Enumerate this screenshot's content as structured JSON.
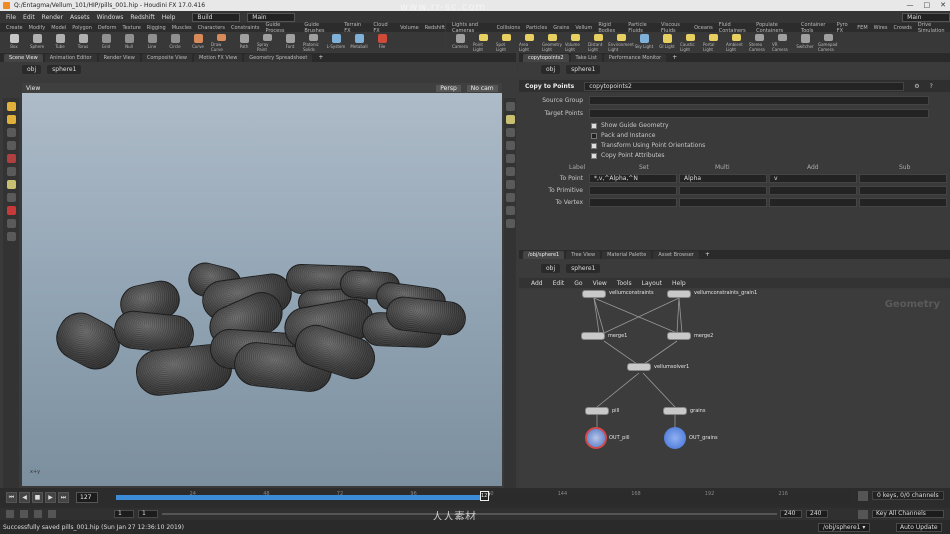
{
  "window": {
    "title": "Q:/Entagma/Vellum_101/HIP/pills_001.hip - Houdini FX 17.0.416",
    "controls": [
      "—",
      "□",
      "✕"
    ]
  },
  "watermark": {
    "top": "www.rr-sc.com",
    "bottom": "人人素材"
  },
  "menubar": {
    "items": [
      "File",
      "Edit",
      "Render",
      "Assets",
      "Windows",
      "Redshift",
      "Help"
    ],
    "desktop": "Build",
    "context": "Main"
  },
  "shelf_tabs_left": [
    "Create",
    "Modify",
    "Model",
    "Polygon",
    "Deform",
    "Texture",
    "Rigging",
    "Muscles",
    "Characters",
    "Constraints",
    "Guide Process",
    "Guide Brushes",
    "Terrain FX",
    "Cloud FX",
    "Volume",
    "Redshift"
  ],
  "shelf_tabs_right": [
    "Lights and Cameras",
    "Collisions",
    "Particles",
    "Grains",
    "Vellum",
    "Rigid Bodies",
    "Particle Fluids",
    "Viscous Fluids",
    "Oceans",
    "Fluid Containers",
    "Populate Containers",
    "Container Tools",
    "Pyro FX",
    "FEM",
    "Wires",
    "Crowds",
    "Drive Simulation"
  ],
  "shelf_tools_left": [
    {
      "label": "Box",
      "color": "#c7c7c7"
    },
    {
      "label": "Sphere",
      "color": "#b0b0b0"
    },
    {
      "label": "Tube",
      "color": "#b0b0b0"
    },
    {
      "label": "Torus",
      "color": "#b0b0b0"
    },
    {
      "label": "Grid",
      "color": "#909090"
    },
    {
      "label": "Null",
      "color": "#909090"
    },
    {
      "label": "Line",
      "color": "#909090"
    },
    {
      "label": "Circle",
      "color": "#909090"
    },
    {
      "label": "Curve",
      "color": "#d88a5a"
    },
    {
      "label": "Draw Curve",
      "color": "#d88a5a"
    },
    {
      "label": "Path",
      "color": "#a0a0a0"
    },
    {
      "label": "Spray Paint",
      "color": "#a0a0a0"
    },
    {
      "label": "Font",
      "color": "#a0a0a0"
    },
    {
      "label": "Platonic Solids",
      "color": "#a0a0a0"
    },
    {
      "label": "L-System",
      "color": "#7fb0d8"
    },
    {
      "label": "Metaball",
      "color": "#7fb0d8"
    },
    {
      "label": "File",
      "color": "#d04a3a"
    }
  ],
  "shelf_tools_right": [
    {
      "label": "Camera",
      "color": "#a0a0a0"
    },
    {
      "label": "Point Light",
      "color": "#e8d060"
    },
    {
      "label": "Spot Light",
      "color": "#e8d060"
    },
    {
      "label": "Area Light",
      "color": "#e8d060"
    },
    {
      "label": "Geometry Light",
      "color": "#e8d060"
    },
    {
      "label": "Volume Light",
      "color": "#e8d060"
    },
    {
      "label": "Distant Light",
      "color": "#e8d060"
    },
    {
      "label": "Environment Light",
      "color": "#e8d060"
    },
    {
      "label": "Sky Light",
      "color": "#7fb0d8"
    },
    {
      "label": "GI Light",
      "color": "#e8d060"
    },
    {
      "label": "Caustic Light",
      "color": "#e8d060"
    },
    {
      "label": "Portal Light",
      "color": "#e8d060"
    },
    {
      "label": "Ambient Light",
      "color": "#e8d060"
    },
    {
      "label": "Stereo Camera",
      "color": "#a0a0a0"
    },
    {
      "label": "VR Camera",
      "color": "#a0a0a0"
    },
    {
      "label": "Switcher",
      "color": "#a0a0a0"
    },
    {
      "label": "Gamepad Camera",
      "color": "#a0a0a0"
    }
  ],
  "left_pane": {
    "tabs": [
      "Scene View",
      "Animation Editor",
      "Render View",
      "Composite View",
      "Motion FX View",
      "Geometry Spreadsheet"
    ],
    "path": [
      "obj",
      "sphere1"
    ],
    "viewport_label": "View",
    "persp": "Persp",
    "cam": "No cam",
    "axis_label": "x+y"
  },
  "right_pane": {
    "tabs": [
      "copytopoints2",
      "Take List",
      "Performance Monitor"
    ],
    "path": [
      "obj",
      "sphere1"
    ],
    "node_type": "Copy to Points",
    "node_name": "copytopoints2",
    "fields": [
      {
        "label": "Source Group",
        "value": ""
      },
      {
        "label": "Target Points",
        "value": ""
      }
    ],
    "checkboxes": [
      {
        "label": "Show Guide Geometry",
        "checked": true
      },
      {
        "label": "Pack and Instance",
        "checked": false
      },
      {
        "label": "Transform Using Point Orientations",
        "checked": true
      },
      {
        "label": "Copy Point Attributes",
        "checked": true
      }
    ],
    "attr_columns": [
      "Label",
      "Set",
      "Multi",
      "Add",
      "Sub"
    ],
    "attr_rows": [
      {
        "label": "To Point",
        "set": "*,v,^Alpha,^N",
        "multi": "Alpha",
        "add": "v",
        "sub": ""
      },
      {
        "label": "To Primitive",
        "set": "",
        "multi": "",
        "add": "",
        "sub": ""
      },
      {
        "label": "To Vertex",
        "set": "",
        "multi": "",
        "add": "",
        "sub": ""
      }
    ]
  },
  "network": {
    "tabs": [
      "/obj/sphere1",
      "Tree View",
      "Material Palette",
      "Asset Browser"
    ],
    "path": [
      "obj",
      "sphere1"
    ],
    "menu": [
      "Add",
      "Edit",
      "Go",
      "View",
      "Tools",
      "Layout",
      "Help"
    ],
    "context_label": "Geometry",
    "nodes": [
      {
        "name": "vellumconstraints",
        "kind": "node"
      },
      {
        "name": "vellumconstraints_grain1",
        "kind": "node"
      },
      {
        "name": "merge1",
        "kind": "node"
      },
      {
        "name": "merge2",
        "kind": "node"
      },
      {
        "name": "vellumsolver1",
        "kind": "node"
      },
      {
        "name": "pill",
        "kind": "node"
      },
      {
        "name": "grains",
        "kind": "node"
      },
      {
        "name": "OUT_pill",
        "kind": "out"
      },
      {
        "name": "OUT_grains",
        "kind": "out"
      }
    ]
  },
  "timeline": {
    "current_frame": "127",
    "ticks": [
      "24",
      "48",
      "72",
      "96",
      "120",
      "144",
      "168",
      "192",
      "216"
    ],
    "progress": 0.5,
    "cursor_label": "127",
    "start": "1",
    "start2": "1",
    "end": "240",
    "end2": "240",
    "keys_label": "0 keys, 0/0 channels",
    "key_all": "Key All Channels",
    "auto_update": "Auto Update"
  },
  "status": {
    "message": "Successfully saved pills_001.hip (Sun Jan 27 12:36:10 2019)"
  },
  "colors": {
    "accent": "#3c8bd6",
    "out_pill": "#4a72c8",
    "out_grains": "#3f6fd6"
  }
}
